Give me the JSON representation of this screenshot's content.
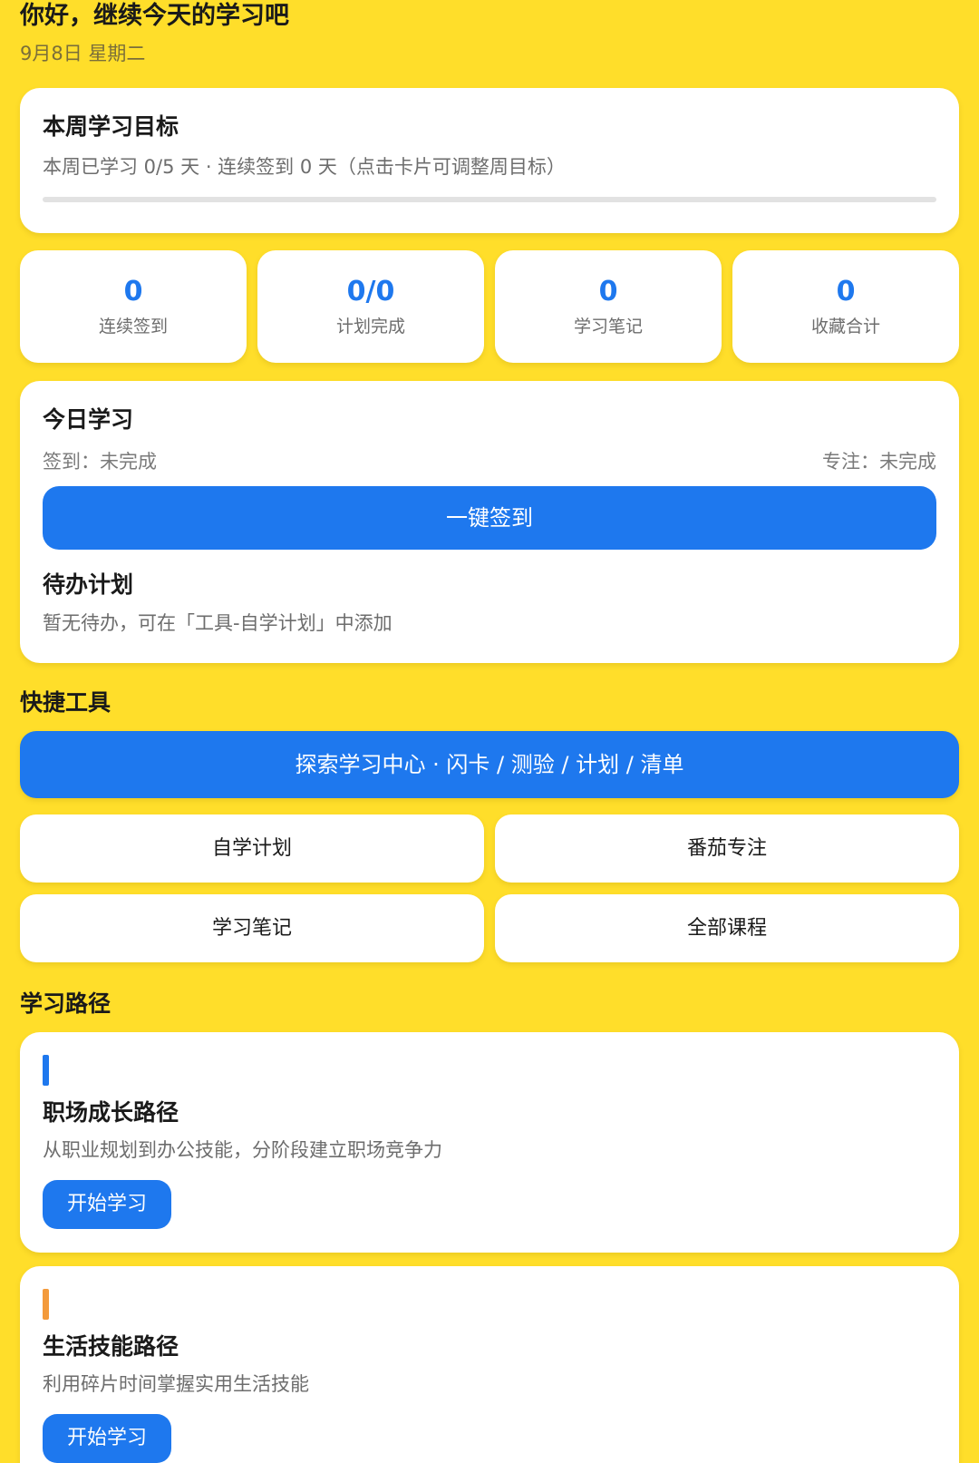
{
  "header": {
    "greeting": "你好，继续今天的学习吧",
    "date": "9月8日 星期二"
  },
  "weekly_goal": {
    "title": "本周学习目标",
    "summary": "本周已学习 0/5 天 · 连续签到 0 天（点击卡片可调整周目标）",
    "progress_fraction": 0
  },
  "stats": [
    {
      "value": "0",
      "label": "连续签到"
    },
    {
      "value": "0/0",
      "label": "计划完成"
    },
    {
      "value": "0",
      "label": "学习笔记"
    },
    {
      "value": "0",
      "label": "收藏合计"
    }
  ],
  "today": {
    "title": "今日学习",
    "checkin_status": "签到：未完成",
    "focus_status": "专注：未完成",
    "checkin_button": "一键签到",
    "todo_title": "待办计划",
    "todo_empty": "暂无待办，可在「工具-自学计划」中添加"
  },
  "quick_tools": {
    "title": "快捷工具",
    "explore_button": "探索学习中心 · 闪卡 / 测验 / 计划 / 清单",
    "buttons": [
      "自学计划",
      "番茄专注",
      "学习笔记",
      "全部课程"
    ]
  },
  "learning_paths": {
    "title": "学习路径",
    "items": [
      {
        "title": "职场成长路径",
        "desc": "从职业规划到办公技能，分阶段建立职场竞争力",
        "button": "开始学习",
        "accent": "#1E78EE"
      },
      {
        "title": "生活技能路径",
        "desc": "利用碎片时间掌握实用生活技能",
        "button": "开始学习",
        "accent": "#F39A3B"
      }
    ]
  },
  "colors": {
    "background": "#FFDE2A",
    "primary": "#1E78EE"
  }
}
